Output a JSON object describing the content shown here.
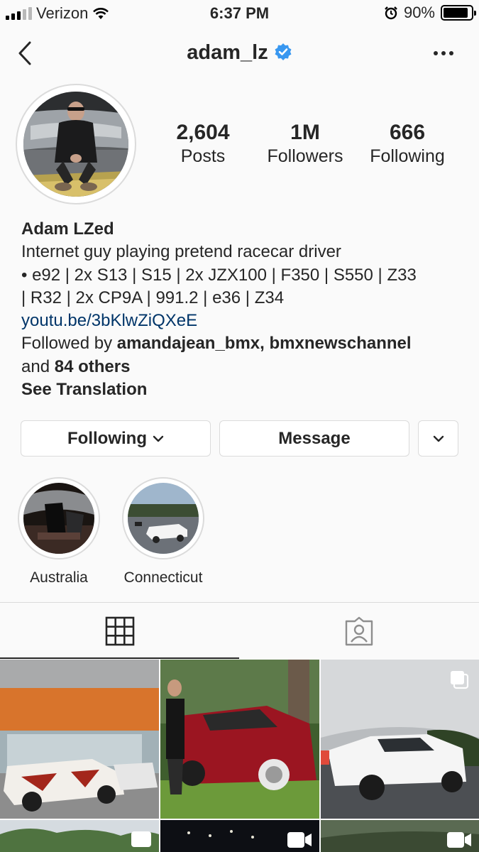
{
  "status": {
    "carrier": "Verizon",
    "time": "6:37 PM",
    "battery": "90%",
    "icons": [
      "signal-icon",
      "wifi-icon",
      "alarm-icon",
      "battery-icon"
    ]
  },
  "header": {
    "username": "adam_lz",
    "icons": [
      "back-icon",
      "verified-badge-icon",
      "more-icon"
    ]
  },
  "stats": [
    {
      "value": "2,604",
      "label": "Posts"
    },
    {
      "value": "1M",
      "label": "Followers"
    },
    {
      "value": "666",
      "label": "Following"
    }
  ],
  "bio": {
    "name": "Adam LZed",
    "line1": "Internet guy playing pretend racecar driver",
    "line2": "• e92 | 2x S13 | S15 | 2x JZX100 | F350 | S550 | Z33",
    "line3": "| R32 | 2x CP9A | 991.2 | e36 | Z34",
    "link": "youtu.be/3bKlwZiQXeE",
    "followed_prefix": "Followed by ",
    "followed_users": "amandajean_bmx, bmxnewschannel",
    "followed_and": "and ",
    "followed_others": "84 others",
    "see_translation": "See Translation"
  },
  "buttons": {
    "following": "Following",
    "message": "Message"
  },
  "highlights": [
    {
      "label": "Australia"
    },
    {
      "label": "Connecticut"
    }
  ],
  "tabs": {
    "icons": [
      "grid-icon",
      "tagged-icon"
    ],
    "active": "grid"
  },
  "posts": {
    "badges": [
      "carousel-icon",
      "video-icon"
    ]
  },
  "colors": {
    "background": "#fafafa",
    "text": "#262626",
    "link": "#003569",
    "verified": "#3897f0",
    "border": "#dbdbdb"
  }
}
